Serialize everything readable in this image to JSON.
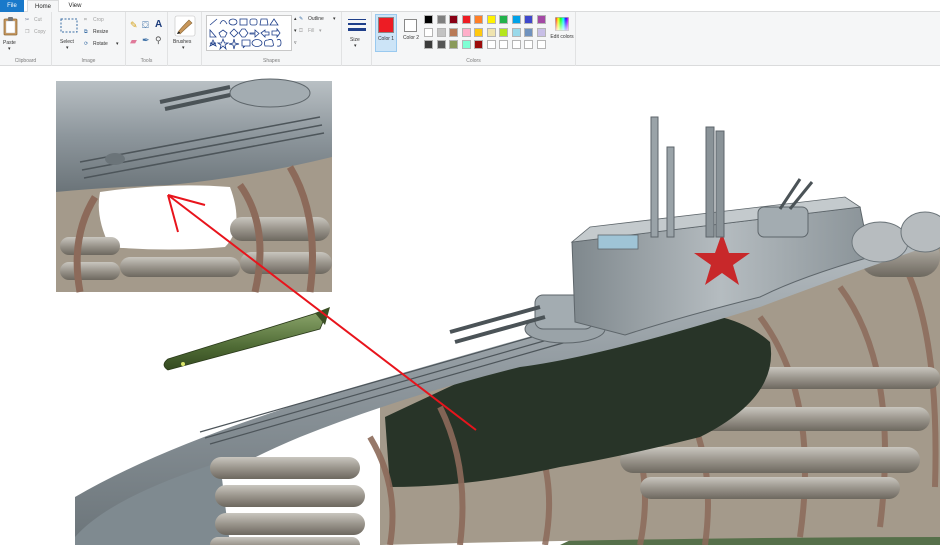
{
  "tabs": {
    "file": "File",
    "home": "Home",
    "view": "View"
  },
  "clipboard": {
    "paste": "Paste",
    "cut": "Cut",
    "copy": "Copy",
    "label": "Clipboard"
  },
  "image": {
    "select": "Select",
    "crop": "Crop",
    "resize": "Resize",
    "rotate": "Rotate",
    "label": "Image"
  },
  "tools": {
    "label": "Tools"
  },
  "brushes": {
    "label": "Brushes"
  },
  "shapes": {
    "outline": "Outline",
    "fill": "Fill",
    "label": "Shapes"
  },
  "size": {
    "label": "Size"
  },
  "colors": {
    "color1": "Color 1",
    "color2": "Color 2",
    "edit": "Edit colors",
    "label": "Colors",
    "color1_value": "#ed1c24",
    "color2_value": "#ffffff",
    "palette_row1": [
      "#000000",
      "#7f7f7f",
      "#880015",
      "#ed1c24",
      "#ff7f27",
      "#fff200",
      "#22b14c",
      "#00a2e8",
      "#3f48cc",
      "#a349a4"
    ],
    "palette_row2": [
      "#ffffff",
      "#c3c3c3",
      "#b97a57",
      "#ffaec9",
      "#ffc90e",
      "#efe4b0",
      "#b5e61d",
      "#99d9ea",
      "#7092be",
      "#c8bfe7"
    ],
    "palette_row3": [
      "#3b3b3b",
      "#555555",
      "#8a9a5b",
      "#7fffd4",
      "#9b0a0a",
      "#ffffff",
      "#ffffff",
      "#ffffff",
      "#ffffff",
      "#ffffff"
    ]
  }
}
